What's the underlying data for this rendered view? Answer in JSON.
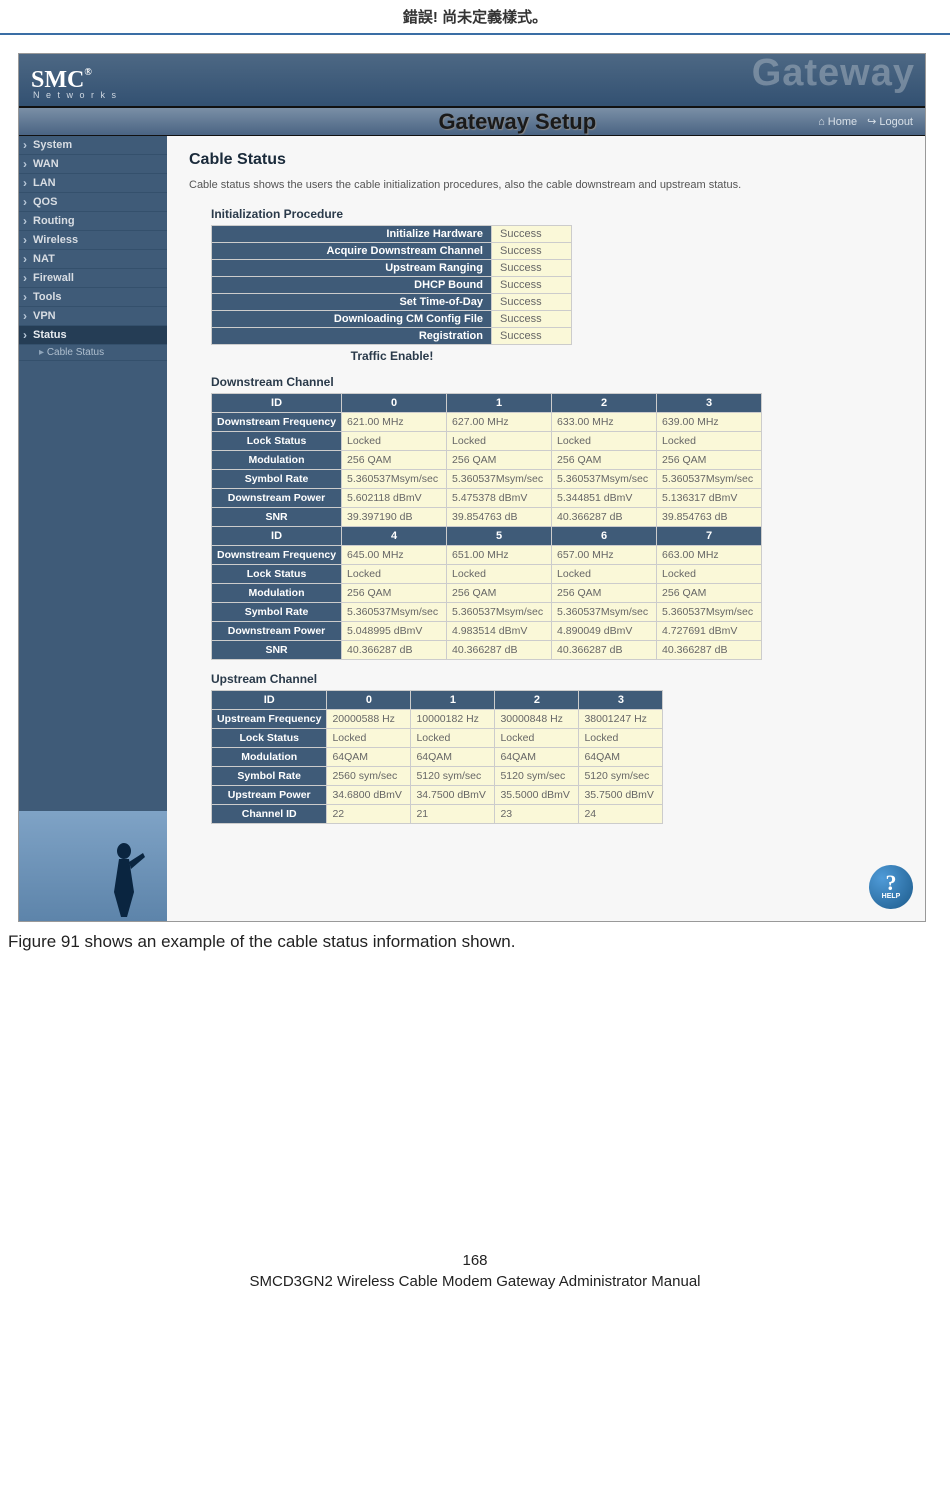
{
  "doc": {
    "header": "錯誤! 尚未定義樣式。",
    "caption": "Figure 91 shows an example of the cable status information shown.",
    "page_num": "168",
    "manual": "SMCD3GN2 Wireless Cable Modem Gateway Administrator Manual"
  },
  "app": {
    "brand": "SMC",
    "brand_sub": "N e t w o r k s",
    "banner_bg": "Gateway",
    "setup_title": "Gateway Setup",
    "home": "Home",
    "logout": "Logout"
  },
  "sidebar": {
    "items": [
      "System",
      "WAN",
      "LAN",
      "QOS",
      "Routing",
      "Wireless",
      "NAT",
      "Firewall",
      "Tools",
      "VPN",
      "Status"
    ],
    "sub": "Cable Status"
  },
  "page": {
    "title": "Cable Status",
    "intro": "Cable status shows the users the cable initialization procedures, also the cable downstream and upstream status."
  },
  "init": {
    "title": "Initialization Procedure",
    "rows": [
      {
        "label": "Initialize Hardware",
        "val": "Success"
      },
      {
        "label": "Acquire Downstream Channel",
        "val": "Success"
      },
      {
        "label": "Upstream Ranging",
        "val": "Success"
      },
      {
        "label": "DHCP Bound",
        "val": "Success"
      },
      {
        "label": "Set Time-of-Day",
        "val": "Success"
      },
      {
        "label": "Downloading CM Config File",
        "val": "Success"
      },
      {
        "label": "Registration",
        "val": "Success"
      }
    ],
    "traffic": "Traffic Enable!"
  },
  "down": {
    "title": "Downstream Channel",
    "id_label": "ID",
    "ids_a": [
      "0",
      "1",
      "2",
      "3"
    ],
    "ids_b": [
      "4",
      "5",
      "6",
      "7"
    ],
    "rows": [
      "Downstream Frequency",
      "Lock Status",
      "Modulation",
      "Symbol Rate",
      "Downstream Power",
      "SNR"
    ],
    "set_a": {
      "freq": [
        "621.00 MHz",
        "627.00 MHz",
        "633.00 MHz",
        "639.00 MHz"
      ],
      "lock": [
        "Locked",
        "Locked",
        "Locked",
        "Locked"
      ],
      "mod": [
        "256 QAM",
        "256 QAM",
        "256 QAM",
        "256 QAM"
      ],
      "sym": [
        "5.360537Msym/sec",
        "5.360537Msym/sec",
        "5.360537Msym/sec",
        "5.360537Msym/sec"
      ],
      "pow": [
        "5.602118 dBmV",
        "5.475378 dBmV",
        "5.344851 dBmV",
        "5.136317 dBmV"
      ],
      "snr": [
        "39.397190 dB",
        "39.854763 dB",
        "40.366287 dB",
        "39.854763 dB"
      ]
    },
    "set_b": {
      "freq": [
        "645.00 MHz",
        "651.00 MHz",
        "657.00 MHz",
        "663.00 MHz"
      ],
      "lock": [
        "Locked",
        "Locked",
        "Locked",
        "Locked"
      ],
      "mod": [
        "256 QAM",
        "256 QAM",
        "256 QAM",
        "256 QAM"
      ],
      "sym": [
        "5.360537Msym/sec",
        "5.360537Msym/sec",
        "5.360537Msym/sec",
        "5.360537Msym/sec"
      ],
      "pow": [
        "5.048995 dBmV",
        "4.983514 dBmV",
        "4.890049 dBmV",
        "4.727691 dBmV"
      ],
      "snr": [
        "40.366287 dB",
        "40.366287 dB",
        "40.366287 dB",
        "40.366287 dB"
      ]
    }
  },
  "up": {
    "title": "Upstream Channel",
    "id_label": "ID",
    "ids": [
      "0",
      "1",
      "2",
      "3"
    ],
    "rows": [
      "Upstream Frequency",
      "Lock Status",
      "Modulation",
      "Symbol Rate",
      "Upstream Power",
      "Channel ID"
    ],
    "data": {
      "freq": [
        "20000588 Hz",
        "10000182 Hz",
        "30000848 Hz",
        "38001247 Hz"
      ],
      "lock": [
        "Locked",
        "Locked",
        "Locked",
        "Locked"
      ],
      "mod": [
        "64QAM",
        "64QAM",
        "64QAM",
        "64QAM"
      ],
      "sym": [
        "2560 sym/sec",
        "5120 sym/sec",
        "5120 sym/sec",
        "5120 sym/sec"
      ],
      "pow": [
        "34.6800 dBmV",
        "34.7500 dBmV",
        "35.5000 dBmV",
        "35.7500 dBmV"
      ],
      "cid": [
        "22",
        "21",
        "23",
        "24"
      ]
    }
  },
  "help": {
    "q": "?",
    "label": "HELP"
  }
}
